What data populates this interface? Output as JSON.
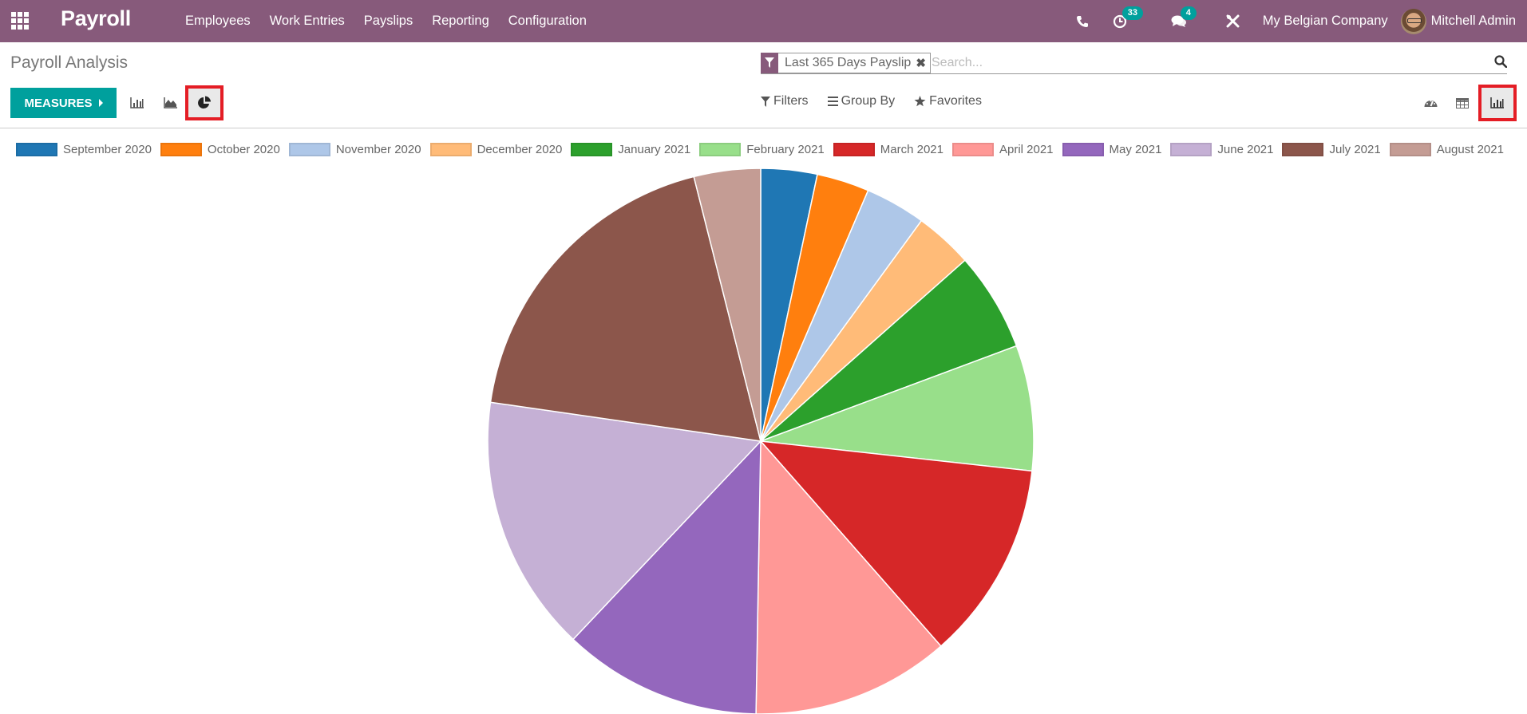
{
  "navbar": {
    "app_name": "Payroll",
    "menu": [
      "Employees",
      "Work Entries",
      "Payslips",
      "Reporting",
      "Configuration"
    ],
    "activity_count": "33",
    "message_count": "4",
    "company": "My Belgian Company",
    "user": "Mitchell Admin",
    "color": "#875A7B"
  },
  "control_panel": {
    "breadcrumb": "Payroll Analysis",
    "measures_label": "MEASURES",
    "chart_types": [
      "bar",
      "line",
      "pie"
    ],
    "active_chart_type": "pie",
    "search": {
      "facet_label": "Last 365 Days Payslip",
      "placeholder": "Search..."
    },
    "filters_label": "Filters",
    "group_by_label": "Group By",
    "favorites_label": "Favorites",
    "views": [
      "dashboard",
      "pivot",
      "graph"
    ],
    "active_view": "graph",
    "accent": "#00A09D"
  },
  "chart_data": {
    "type": "pie",
    "title": "",
    "legend_position": "top",
    "unit": "percent_of_total",
    "categories": [
      "September 2020",
      "October 2020",
      "November 2020",
      "December 2020",
      "January 2021",
      "February 2021",
      "March 2021",
      "April 2021",
      "May 2021",
      "June 2021",
      "July 2021",
      "August 2021"
    ],
    "values": [
      3.33,
      3.11,
      3.58,
      3.44,
      5.86,
      7.42,
      11.78,
      11.75,
      11.78,
      15.22,
      18.78,
      3.94
    ],
    "colors": [
      "#1f77b4",
      "#ff7f0e",
      "#aec7e8",
      "#ffbb78",
      "#2ca02c",
      "#98df8a",
      "#d62728",
      "#ff9896",
      "#9467bd",
      "#c5b0d5",
      "#8c564b",
      "#c49c94"
    ]
  }
}
